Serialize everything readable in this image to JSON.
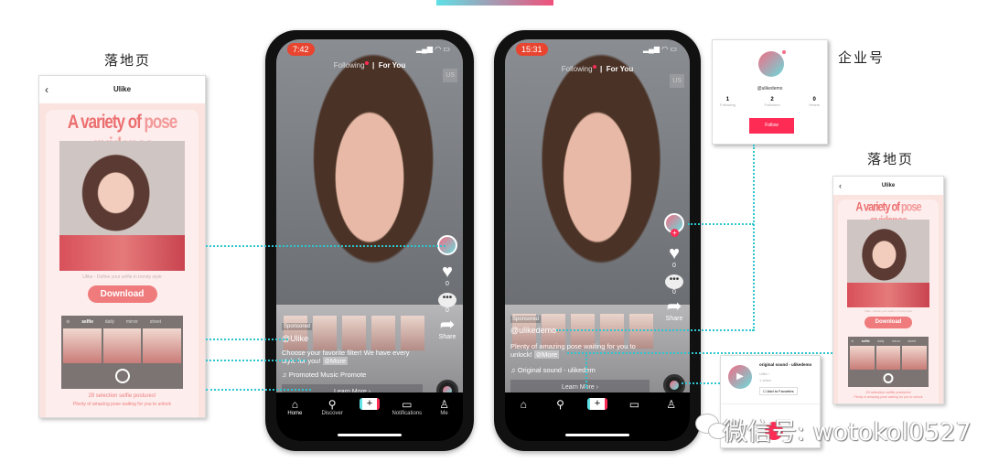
{
  "labels": {
    "landing_left": "落地页",
    "enterprise": "企业号",
    "landing_right": "落地页"
  },
  "landing": {
    "back_icon": "chevron-left-icon",
    "app_name": "Ulike",
    "title_a": "A variety of ",
    "title_b": "pose guidance",
    "caption": "Ulike - Define your selfie in trendy style",
    "download": "Download",
    "tabs": [
      "⊘",
      "selfie",
      "daily",
      "mirror",
      "street"
    ],
    "foot1": "29 selection selfie postures!",
    "foot2": "Plenty of amazing pose waiting for you to unlock"
  },
  "phone1": {
    "time": "7:42",
    "status": "▂▄▆ ◠ ▭",
    "tab_following": "Following",
    "tab_foryou": "For You",
    "region": "US",
    "likes": "0",
    "comments": "0",
    "share": "Share",
    "sponsored": "Sponsored",
    "account": "@Ulike",
    "desc": "Choose your favorite filter! We have every style for you!",
    "more": "⊘More",
    "music": "♫  Promoted Music   Promote",
    "learn_more": "Learn More  ›"
  },
  "phone2": {
    "time": "15:31",
    "status": "▂▄▆ ◠ ▭",
    "tab_following": "Following",
    "tab_foryou": "For You",
    "region": "US",
    "likes": "0",
    "comments": "0",
    "share": "Share",
    "sponsored": "Sponsored",
    "account": "@ulikedemo",
    "desc": "Plenty of amazing pose waiting for you to unlock!",
    "more": "⊘More",
    "music": "♫  Original sound - ulikedem",
    "learn_more": "Learn More  ›"
  },
  "nav": [
    {
      "icon": "⌂",
      "label": "Home"
    },
    {
      "icon": "⚲",
      "label": "Discover"
    },
    {
      "icon": "+",
      "label": ""
    },
    {
      "icon": "▭",
      "label": "Notifications"
    },
    {
      "icon": "♙",
      "label": "Me"
    }
  ],
  "profile": {
    "handle": "@ulikedemo",
    "stats": [
      {
        "n": "1",
        "l": "Following"
      },
      {
        "n": "2",
        "l": "Followers"
      },
      {
        "n": "0",
        "l": "Hearts"
      }
    ],
    "follow": "Follow"
  },
  "sound": {
    "title": "original sound - ulikedemo",
    "author": "Ulike  ›",
    "count": "1 video",
    "fav": "☐ Add to Favorites"
  },
  "watermark": "微信号: wotokol0527",
  "colors": {
    "accent": "#fe2c55",
    "cyan": "#2cc6cf",
    "landing": "#ef7b7c"
  }
}
